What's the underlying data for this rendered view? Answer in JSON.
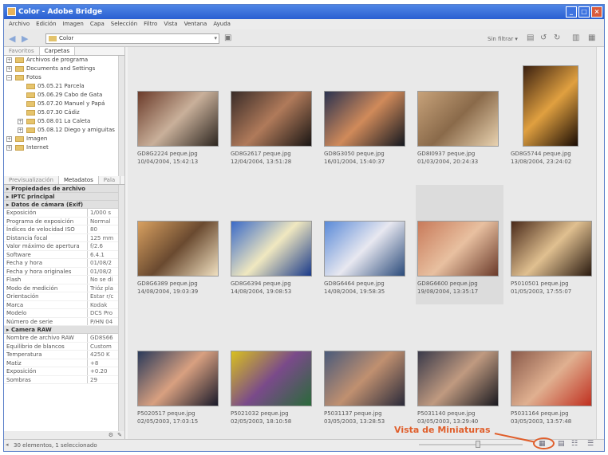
{
  "window": {
    "title": "Color - Adobe Bridge"
  },
  "menu": [
    "Archivo",
    "Edición",
    "Imagen",
    "Capa",
    "Selección",
    "Filtro",
    "Vista",
    "Ventana",
    "Ayuda"
  ],
  "toolbar": {
    "path_label": "Color",
    "filter_label": "Sin filtrar ▾"
  },
  "left_tabs": {
    "favorites": "Favoritos",
    "folders": "Carpetas"
  },
  "folders": [
    {
      "label": "Archivos de programa",
      "level": 0,
      "expand": "+"
    },
    {
      "label": "Documents and Settings",
      "level": 0,
      "expand": "+"
    },
    {
      "label": "Fotos",
      "level": 0,
      "expand": "−"
    },
    {
      "label": "05.05.21 Parcela",
      "level": 1,
      "expand": ""
    },
    {
      "label": "05.06.29 Cabo de Gata",
      "level": 1,
      "expand": ""
    },
    {
      "label": "05.07.20 Manuel y Papá",
      "level": 1,
      "expand": ""
    },
    {
      "label": "05.07.30 Cádiz",
      "level": 1,
      "expand": ""
    },
    {
      "label": "05.08.01 La Caleta",
      "level": 1,
      "expand": "+"
    },
    {
      "label": "05.08.12 Diego y amiguitas",
      "level": 1,
      "expand": "+"
    },
    {
      "label": "Imagen",
      "level": 0,
      "expand": "+"
    },
    {
      "label": "Internet",
      "level": 0,
      "expand": "+"
    }
  ],
  "meta_tabs": {
    "preview": "Previsualización",
    "metadata": "Metadatos",
    "keywords": "Pala"
  },
  "metadata": {
    "sections_collapsed": [
      "Propiedades de archivo",
      "IPTC principal"
    ],
    "camera_title": "Datos de cámara (Exif)",
    "camera": [
      {
        "k": "Exposición",
        "v": "1/000 s"
      },
      {
        "k": "Programa de exposición",
        "v": "Normal"
      },
      {
        "k": "Índices de velocidad ISO",
        "v": "80"
      },
      {
        "k": "Distancia focal",
        "v": "125 mm"
      },
      {
        "k": "Valor máximo de apertura",
        "v": "f/2.6"
      },
      {
        "k": "Software",
        "v": "6.4.1"
      },
      {
        "k": "Fecha y hora",
        "v": "01/08/2"
      },
      {
        "k": "Fecha y hora originales",
        "v": "01/08/2"
      },
      {
        "k": "Flash",
        "v": "No se di"
      },
      {
        "k": "Modo de medición",
        "v": "Trióz pla"
      },
      {
        "k": "Orientación",
        "v": "Estar r/c"
      },
      {
        "k": "Marca",
        "v": "Kodak"
      },
      {
        "k": "Modelo",
        "v": "DCS Pro"
      },
      {
        "k": "Número de serie",
        "v": "P/HN 04"
      }
    ],
    "raw_title": "Camera RAW",
    "raw": [
      {
        "k": "Nombre de archivo RAW",
        "v": "GD8S66"
      },
      {
        "k": "Equilibrio de blancos",
        "v": "Custom"
      },
      {
        "k": "Temperatura",
        "v": "4250 K"
      },
      {
        "k": "Matiz",
        "v": "+8"
      },
      {
        "k": "Exposición",
        "v": "+0.20"
      },
      {
        "k": "Sombras",
        "v": "29"
      }
    ]
  },
  "thumbnails": [
    {
      "name": "GD8G2224 peque.jpg",
      "date": "10/04/2004, 15:42:13",
      "colors": [
        "#6b3b2a",
        "#c9b09a",
        "#2d2620"
      ],
      "portrait": false
    },
    {
      "name": "GD8G2617 peque.jpg",
      "date": "12/04/2004, 13:51:28",
      "colors": [
        "#3a2c28",
        "#b07a5a",
        "#1a1614"
      ],
      "portrait": false
    },
    {
      "name": "GD8G3050 peque.jpg",
      "date": "16/01/2004, 15:40:37",
      "colors": [
        "#2a3250",
        "#d08a5a",
        "#141820"
      ],
      "portrait": false
    },
    {
      "name": "GD8I0937 peque.jpg",
      "date": "01/03/2004, 20:24:33",
      "colors": [
        "#c7a27a",
        "#8a6a4a",
        "#e8d2b0"
      ],
      "portrait": false
    },
    {
      "name": "GD8G5744 peque.jpg",
      "date": "13/08/2004, 23:24:02",
      "colors": [
        "#3a2010",
        "#e0a040",
        "#1a0c04"
      ],
      "portrait": true
    },
    {
      "name": "GD8G6389 peque.jpg",
      "date": "14/08/2004, 19:03:39",
      "colors": [
        "#d8a060",
        "#6a4a30",
        "#f0e0c0"
      ],
      "portrait": false
    },
    {
      "name": "GD8G6394 peque.jpg",
      "date": "14/08/2004, 19:08:53",
      "colors": [
        "#3a6ac8",
        "#f0e8c0",
        "#1a3a8a"
      ],
      "portrait": false
    },
    {
      "name": "GD8G6464 peque.jpg",
      "date": "14/08/2004, 19:58:35",
      "colors": [
        "#5a8ad8",
        "#e8e8f0",
        "#2a4a7a"
      ],
      "portrait": false
    },
    {
      "name": "GD8G6600 peque.jpg",
      "date": "19/08/2004, 13:35:17",
      "colors": [
        "#c87a5a",
        "#e8c0a0",
        "#6a3a2a"
      ],
      "portrait": false
    },
    {
      "name": "P5010501 peque.jpg",
      "date": "01/05/2003, 17:55:07",
      "colors": [
        "#4a2a1a",
        "#e0c090",
        "#2a1a10"
      ],
      "portrait": false
    },
    {
      "name": "P5020517 peque.jpg",
      "date": "02/05/2003, 17:03:15",
      "colors": [
        "#2a3a5a",
        "#d8a080",
        "#1a1a2a"
      ],
      "portrait": false
    },
    {
      "name": "P5021032 peque.jpg",
      "date": "02/05/2003, 18:10:58",
      "colors": [
        "#d8c020",
        "#7a4a8a",
        "#2a6a3a"
      ],
      "portrait": false
    },
    {
      "name": "P5031137 peque.jpg",
      "date": "03/05/2003, 13:28:53",
      "colors": [
        "#4a5a7a",
        "#c09070",
        "#2a2a3a"
      ],
      "portrait": false
    },
    {
      "name": "P5031140 peque.jpg",
      "date": "03/05/2003, 13:29:40",
      "colors": [
        "#3a3a4a",
        "#c09a80",
        "#1a1a20"
      ],
      "portrait": false
    },
    {
      "name": "P5031164 peque.jpg",
      "date": "03/05/2003, 13:57:48",
      "colors": [
        "#8a5a4a",
        "#e0b090",
        "#c03020"
      ],
      "portrait": false
    }
  ],
  "selected_index": 8,
  "status": {
    "text": "30 elementos, 1 seleccionado"
  },
  "annotation": {
    "text": "Vista de Miniaturas"
  },
  "accent": "#e05f2c"
}
